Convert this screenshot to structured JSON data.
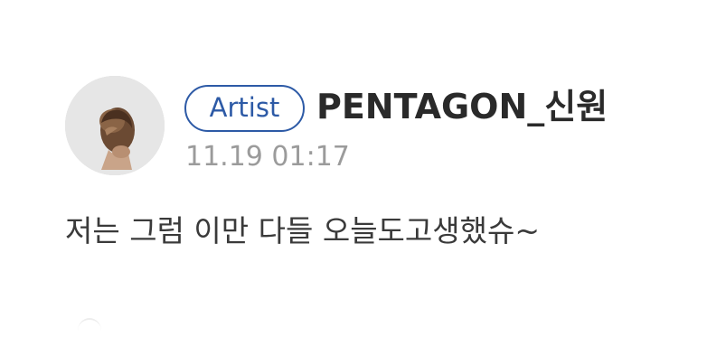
{
  "post": {
    "badge_label": "Artist",
    "username": "PENTAGON_신원",
    "timestamp": "11.19 01:17",
    "message": "저는 그럼 이만 다들 오늘도고생했슈~",
    "avatar_icon": "profile-photo",
    "colors": {
      "badge": "#2d5aa6",
      "username": "#2a2a2a",
      "timestamp": "#9b9b9b",
      "message": "#3a3a3a"
    }
  }
}
